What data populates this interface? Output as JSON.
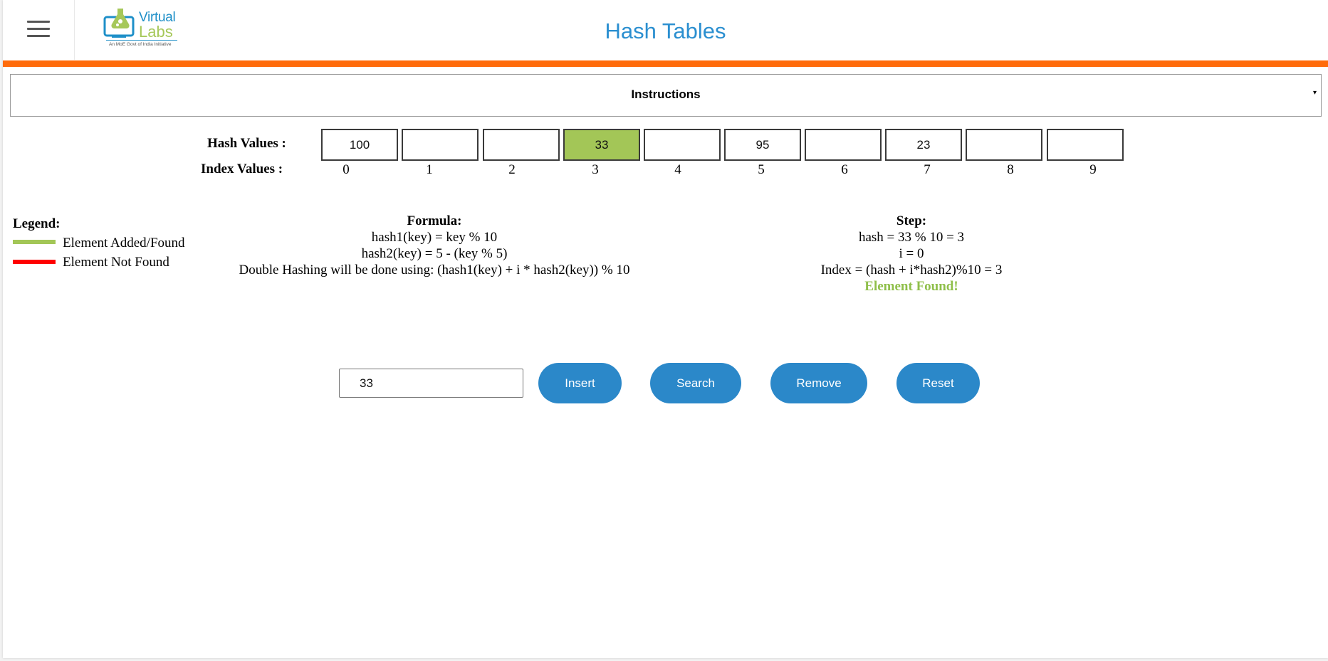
{
  "header": {
    "title": "Hash Tables",
    "logo_line1": "Virtual",
    "logo_line2": "Labs",
    "logo_tagline": "An MoE Govt of India Initiative"
  },
  "instructions": {
    "label": "Instructions"
  },
  "hash_table": {
    "hash_label": "Hash Values :",
    "index_label": "Index Values :",
    "cells": [
      {
        "index": "0",
        "value": "100",
        "found": false
      },
      {
        "index": "1",
        "value": "",
        "found": false
      },
      {
        "index": "2",
        "value": "",
        "found": false
      },
      {
        "index": "3",
        "value": "33",
        "found": true
      },
      {
        "index": "4",
        "value": "",
        "found": false
      },
      {
        "index": "5",
        "value": "95",
        "found": false
      },
      {
        "index": "6",
        "value": "",
        "found": false
      },
      {
        "index": "7",
        "value": "23",
        "found": false
      },
      {
        "index": "8",
        "value": "",
        "found": false
      },
      {
        "index": "9",
        "value": "",
        "found": false
      }
    ]
  },
  "legend": {
    "title": "Legend:",
    "items": [
      {
        "label": "Element Added/Found",
        "color": "#a3c657"
      },
      {
        "label": "Element Not Found",
        "color": "#ff0000"
      }
    ]
  },
  "formula": {
    "title": "Formula:",
    "lines": [
      "hash1(key) = key % 10",
      "hash2(key) = 5 - (key % 5)",
      "Double Hashing will be done using: (hash1(key) + i * hash2(key)) % 10"
    ]
  },
  "step": {
    "title": "Step:",
    "lines": [
      "hash = 33 % 10 = 3",
      "i = 0",
      "Index = (hash + i*hash2)%10 = 3"
    ],
    "result": "Element Found!"
  },
  "controls": {
    "input_value": "33",
    "insert_label": "Insert",
    "search_label": "Search",
    "remove_label": "Remove",
    "reset_label": "Reset"
  },
  "colors": {
    "accent": "#2b88c9",
    "orange_bar": "#ff6b0b",
    "found": "#a3c657",
    "not_found": "#ff0000"
  }
}
